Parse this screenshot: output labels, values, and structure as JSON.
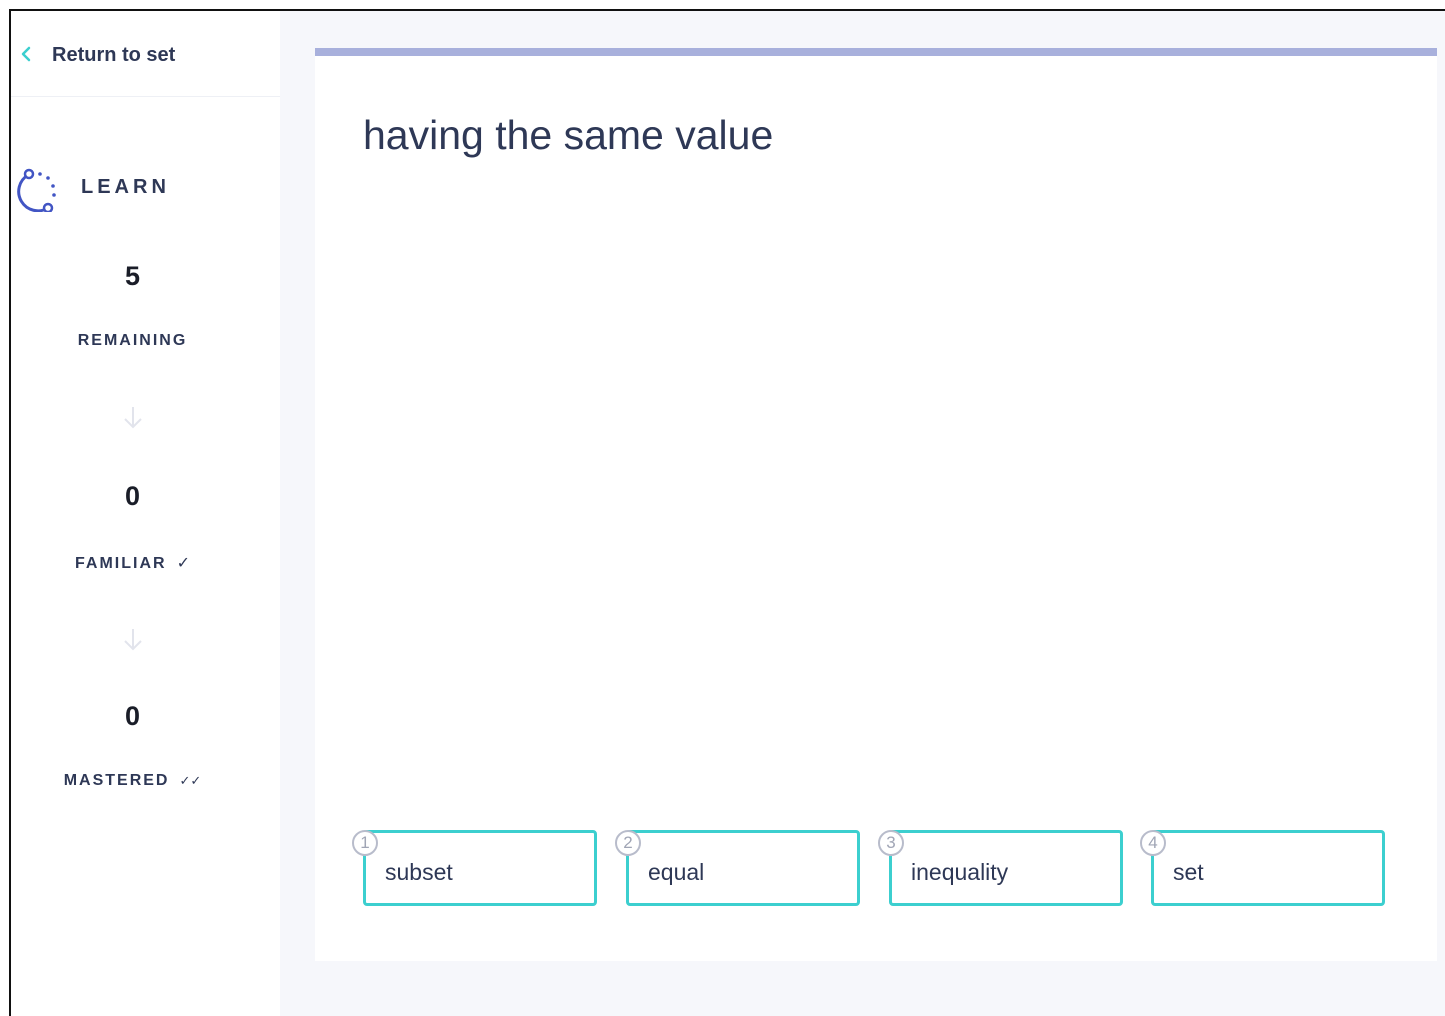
{
  "sidebar": {
    "return_label": "Return to set",
    "mode_label": "LEARN",
    "stats": [
      {
        "count": "5",
        "label": "REMAINING",
        "tick": ""
      },
      {
        "count": "0",
        "label": "FAMILIAR",
        "tick": "✓"
      },
      {
        "count": "0",
        "label": "MASTERED",
        "tick": "✓✓"
      }
    ]
  },
  "question": {
    "prompt": "having the same value"
  },
  "options": [
    {
      "number": "1",
      "text": "subset"
    },
    {
      "number": "2",
      "text": "equal"
    },
    {
      "number": "3",
      "text": "inequality"
    },
    {
      "number": "4",
      "text": "set"
    }
  ],
  "colors": {
    "accent": "#3ccfcf",
    "progress_bar": "#a8b0dc",
    "learn_icon": "#4255c4",
    "text": "#2e3856"
  }
}
